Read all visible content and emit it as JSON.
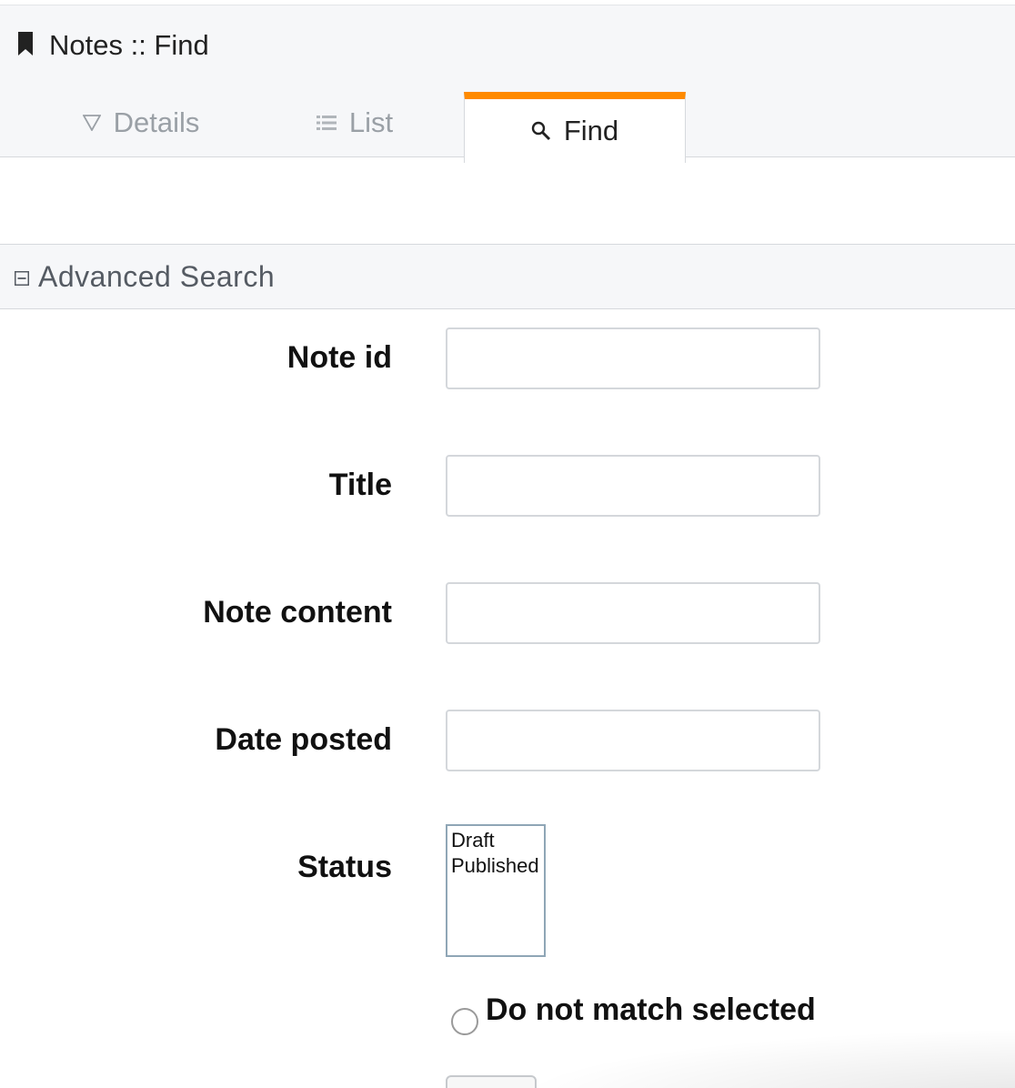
{
  "header": {
    "title": "Notes :: Find",
    "icon": "bookmark-icon"
  },
  "tabs": [
    {
      "label": "Details",
      "icon": "triangle-down-icon",
      "active": false
    },
    {
      "label": "List",
      "icon": "list-icon",
      "active": false
    },
    {
      "label": "Find",
      "icon": "search-icon",
      "active": true
    }
  ],
  "colors": {
    "accent": "#ff8a00",
    "header_bg": "#f6f7f9",
    "inactive_tab_text": "#9aa0a6"
  },
  "section": {
    "title": "Advanced Search",
    "icon": "collapse-icon"
  },
  "form": {
    "note_id": {
      "label": "Note id",
      "value": ""
    },
    "title": {
      "label": "Title",
      "value": ""
    },
    "note_content": {
      "label": "Note content",
      "value": ""
    },
    "date_posted": {
      "label": "Date posted",
      "value": ""
    },
    "status": {
      "label": "Status",
      "options": [
        "Draft",
        "Published"
      ]
    },
    "do_not_match": {
      "label": "Do not match selected",
      "checked": false
    }
  }
}
